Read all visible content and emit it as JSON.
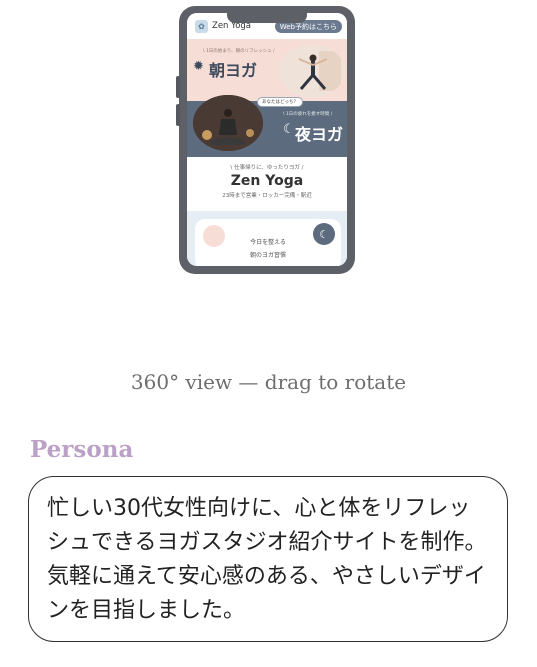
{
  "viewer": {
    "caption": "360° view — drag to rotate"
  },
  "site": {
    "logo_text": "Zen Yoga",
    "reserve_label": "Web予約はこちら",
    "morning": {
      "tagline": "\\ 1日の始まり、朝のリフレッシュ /",
      "title": "朝ヨガ"
    },
    "chip_label": "あなたはどっち？",
    "night": {
      "tagline": "\\ 1日の疲れを癒す時間 /",
      "title": "夜ヨガ"
    },
    "intro": {
      "tagline": "\\ 仕事帰りに、ゆったりヨガ /",
      "brand": "Zen Yoga",
      "hours": "23時まで営業・ロッカー完備・駅近"
    },
    "card": {
      "line1": "今日を整える",
      "line2": "朝のヨガ習慣"
    }
  },
  "persona": {
    "heading": "Persona",
    "text": "忙しい30代女性向けに、心と体をリフレッシュできるヨガスタジオ紹介サイトを制作。気軽に通えて安心感のある、やさしいデザインを目指しました。"
  },
  "colors": {
    "phone_frame": "#5d6066",
    "morning_bg": "#f6ddd6",
    "night_bg": "#5d6b7e",
    "heading_accent": "#bca1c7",
    "caption": "#6e6e6e"
  },
  "icons": {
    "sun": "sun-icon",
    "moon": "moon-icon",
    "logo": "lotus-icon"
  }
}
